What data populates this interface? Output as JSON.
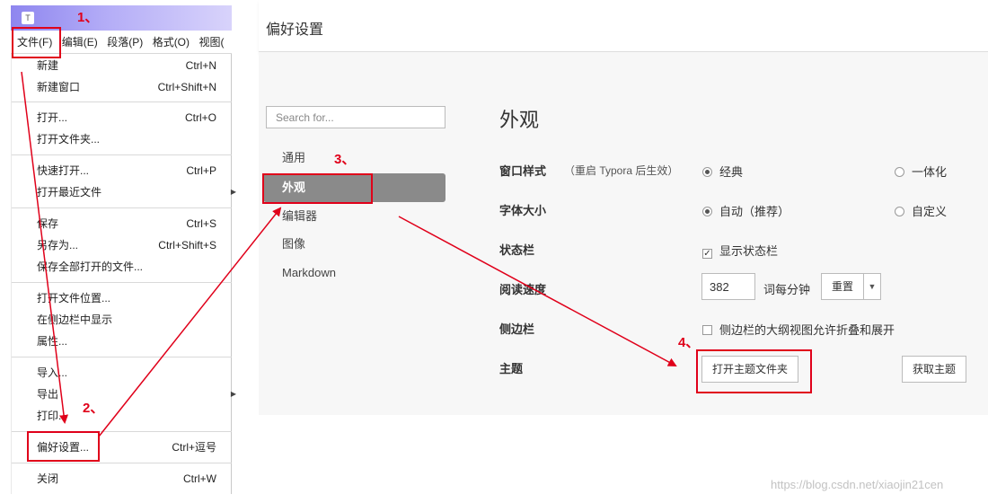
{
  "app": {
    "icon": "T"
  },
  "menubar": [
    "文件(F)",
    "编辑(E)",
    "段落(P)",
    "格式(O)",
    "视图("
  ],
  "file_menu": [
    {
      "label": "新建",
      "shortcut": "Ctrl+N"
    },
    {
      "label": "新建窗口",
      "shortcut": "Ctrl+Shift+N"
    },
    {
      "label": "打开...",
      "shortcut": "Ctrl+O"
    },
    {
      "label": "打开文件夹...",
      "shortcut": ""
    },
    {
      "label": "快速打开...",
      "shortcut": "Ctrl+P"
    },
    {
      "label": "打开最近文件",
      "shortcut": ""
    },
    {
      "label": "保存",
      "shortcut": "Ctrl+S"
    },
    {
      "label": "另存为...",
      "shortcut": "Ctrl+Shift+S"
    },
    {
      "label": "保存全部打开的文件...",
      "shortcut": ""
    },
    {
      "label": "打开文件位置...",
      "shortcut": ""
    },
    {
      "label": "在侧边栏中显示",
      "shortcut": ""
    },
    {
      "label": "属性...",
      "shortcut": ""
    },
    {
      "label": "导入...",
      "shortcut": ""
    },
    {
      "label": "导出",
      "shortcut": ""
    },
    {
      "label": "打印...",
      "shortcut": ""
    },
    {
      "label": "偏好设置...",
      "shortcut": "Ctrl+逗号"
    },
    {
      "label": "关闭",
      "shortcut": "Ctrl+W"
    }
  ],
  "prefs": {
    "title": "偏好设置",
    "search_placeholder": "Search for...",
    "nav": [
      "通用",
      "外观",
      "编辑器",
      "图像",
      "Markdown"
    ],
    "section_title": "外观",
    "window_style": {
      "label": "窗口样式",
      "note": "（重启 Typora 后生效）",
      "opt1": "经典",
      "opt2": "一体化",
      "selected": "经典"
    },
    "font_size": {
      "label": "字体大小",
      "opt1": "自动（推荐）",
      "opt2": "自定义",
      "selected": "自动（推荐）"
    },
    "status_bar": {
      "label": "状态栏",
      "checkbox": "显示状态栏",
      "checked": true
    },
    "reading_speed": {
      "label": "阅读速度",
      "value": "382",
      "unit": "词每分钟",
      "reset": "重置"
    },
    "sidebar": {
      "label": "侧边栏",
      "checkbox": "侧边栏的大纲视图允许折叠和展开",
      "checked": false
    },
    "theme": {
      "label": "主题",
      "open_folder": "打开主题文件夹",
      "get_themes": "获取主题"
    }
  },
  "annotations": {
    "step1": "1、",
    "step2": "2、",
    "step3": "3、",
    "step4": "4、",
    "color": "#e0001a"
  },
  "watermark": "https://blog.csdn.net/xiaojin21cen"
}
